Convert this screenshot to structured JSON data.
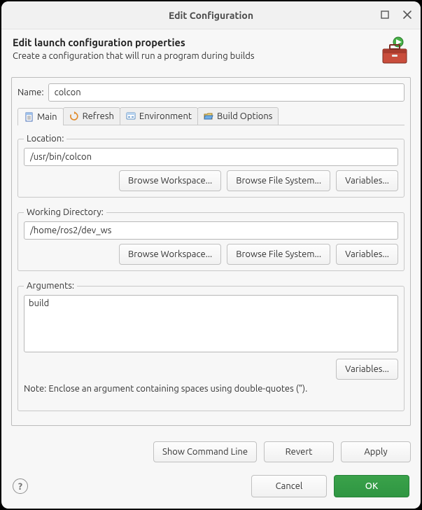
{
  "window": {
    "title": "Edit Configuration"
  },
  "header": {
    "heading": "Edit launch configuration properties",
    "subtext": "Create a configuration that will run a program during builds"
  },
  "form": {
    "name_label": "Name:",
    "name_value": "colcon"
  },
  "tabs": {
    "main": "Main",
    "refresh": "Refresh",
    "environment": "Environment",
    "build": "Build Options"
  },
  "main": {
    "location": {
      "legend": "Location:",
      "value": "/usr/bin/colcon",
      "browse_ws": "Browse Workspace...",
      "browse_fs": "Browse File System...",
      "variables": "Variables..."
    },
    "workdir": {
      "legend": "Working Directory:",
      "value": "/home/ros2/dev_ws",
      "browse_ws": "Browse Workspace...",
      "browse_fs": "Browse File System...",
      "variables": "Variables..."
    },
    "arguments": {
      "legend": "Arguments:",
      "value": "build",
      "variables": "Variables...",
      "note": "Note: Enclose an argument containing spaces using double-quotes (\")."
    }
  },
  "buttons": {
    "show_cmd": "Show Command Line",
    "revert": "Revert",
    "apply": "Apply",
    "cancel": "Cancel",
    "ok": "OK"
  }
}
